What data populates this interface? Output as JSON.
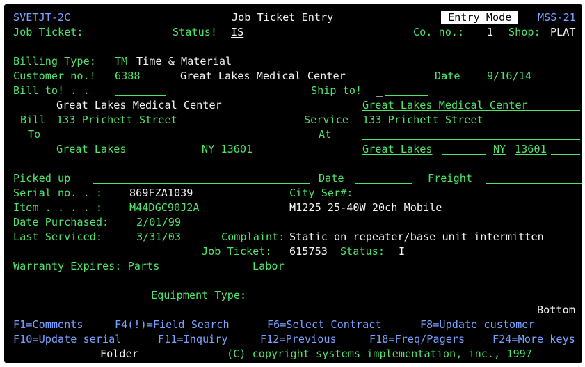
{
  "header": {
    "program_id": "SVETJT-2C",
    "screen_title": "Job Ticket Entry",
    "mode": "Entry Mode",
    "screen_id": "MSS-21",
    "job_ticket_label": "Job Ticket:",
    "status_label": "Status!",
    "status_value": "IS",
    "co_no_label": "Co. no.:",
    "co_no_value": "1",
    "shop_label": "Shop:",
    "shop_value": "PLAT"
  },
  "billing": {
    "type_label": "Billing Type:",
    "type_code": "TM",
    "type_desc": "Time & Material",
    "customer_label": "Customer no.!",
    "customer_no": "6388",
    "customer_name": "Great Lakes Medical Center",
    "date_label": "Date",
    "date_value": "9/16/14",
    "bill_to_label": "Bill to! . .",
    "bill_to_value": "",
    "ship_to_label": "Ship to!",
    "ship_to_value": "_"
  },
  "bill_address": {
    "block_label_1": "Bill",
    "block_label_2": "To",
    "name": "Great Lakes Medical Center",
    "street": "133 Prichett Street",
    "city": "Great Lakes",
    "state_zip": "NY 13601"
  },
  "service_address": {
    "block_label_1": "Service",
    "block_label_2": "At",
    "name": "Great Lakes Medical Center",
    "street": "133 Prichett Street",
    "line3": "",
    "city": "Great Lakes",
    "state": "NY",
    "zip": "13601"
  },
  "pickup": {
    "picked_up_label": "Picked up",
    "picked_up_value": "",
    "date_label": "Date",
    "date_value": "",
    "freight_label": "Freight",
    "freight_value": ""
  },
  "equipment": {
    "serial_label": "Serial no. . :",
    "serial_value": "869FZA1039",
    "city_ser_label": "City Ser#:",
    "item_label": "Item . . . . :",
    "item_value": "M44DGC90J2A",
    "item_desc": "M1225 25-40W 20ch Mobile",
    "date_purchased_label": "Date Purchased:",
    "date_purchased_value": "2/01/99",
    "last_serviced_label": "Last Serviced:",
    "last_serviced_value": "3/31/03",
    "complaint_label": "Complaint:",
    "complaint_value": "Static on repeater/base unit intermitten",
    "job_ticket_label": "Job Ticket:",
    "job_ticket_value": "615753",
    "job_status_label": "Status:",
    "job_status_value": "I",
    "warranty_label": "Warranty Expires: Parts",
    "labor_label": "Labor",
    "equipment_type_label": "Equipment Type:"
  },
  "footer": {
    "bottom_marker": "Bottom",
    "fkeys_row1": [
      "F1=Comments",
      "F4(!)=Field Search",
      "F6=Select Contract",
      "F8=Update customer"
    ],
    "fkeys_row2": [
      "F10=Update serial",
      "F11=Inquiry",
      "F12=Previous",
      "F18=Freq/Pagers",
      "F24=More keys"
    ],
    "folder_label": "Folder",
    "copyright": "(C) copyright systems implementation, inc., 1997"
  },
  "colors": {
    "background": "#000000",
    "field_green": "#4fe36a",
    "text_white": "#f2f2f2",
    "id_blue": "#7aa2ff"
  }
}
